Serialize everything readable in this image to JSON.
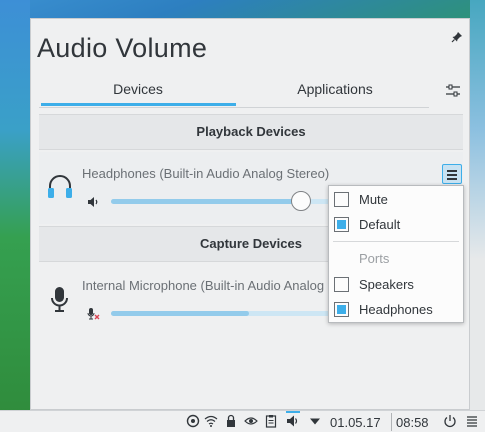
{
  "window": {
    "title": "Audio Volume"
  },
  "tabs": [
    {
      "label": "Devices",
      "active": true
    },
    {
      "label": "Applications",
      "active": false
    }
  ],
  "sections": {
    "playback": "Playback Devices",
    "capture": "Capture Devices"
  },
  "devices": {
    "playback": {
      "name": "Headphones (Built-in Audio Analog Stereo)",
      "icon": "headphones-icon",
      "volume_percent": 73,
      "muted": false
    },
    "capture": {
      "name": "Internal Microphone (Built-in Audio Analog Stereo)",
      "icon": "microphone-icon",
      "volume_percent": 60,
      "muted": true
    }
  },
  "menu": {
    "mute": {
      "label": "Mute",
      "checked": false
    },
    "default": {
      "label": "Default",
      "checked": true
    },
    "ports_header": "Ports",
    "ports": [
      {
        "label": "Speakers",
        "checked": false
      },
      {
        "label": "Headphones",
        "checked": true
      }
    ]
  },
  "taskbar": {
    "date": "01.05.17",
    "time": "08:58"
  },
  "colors": {
    "accent": "#3daee9",
    "panel_bg": "#eff0f1",
    "text": "#31363b"
  }
}
